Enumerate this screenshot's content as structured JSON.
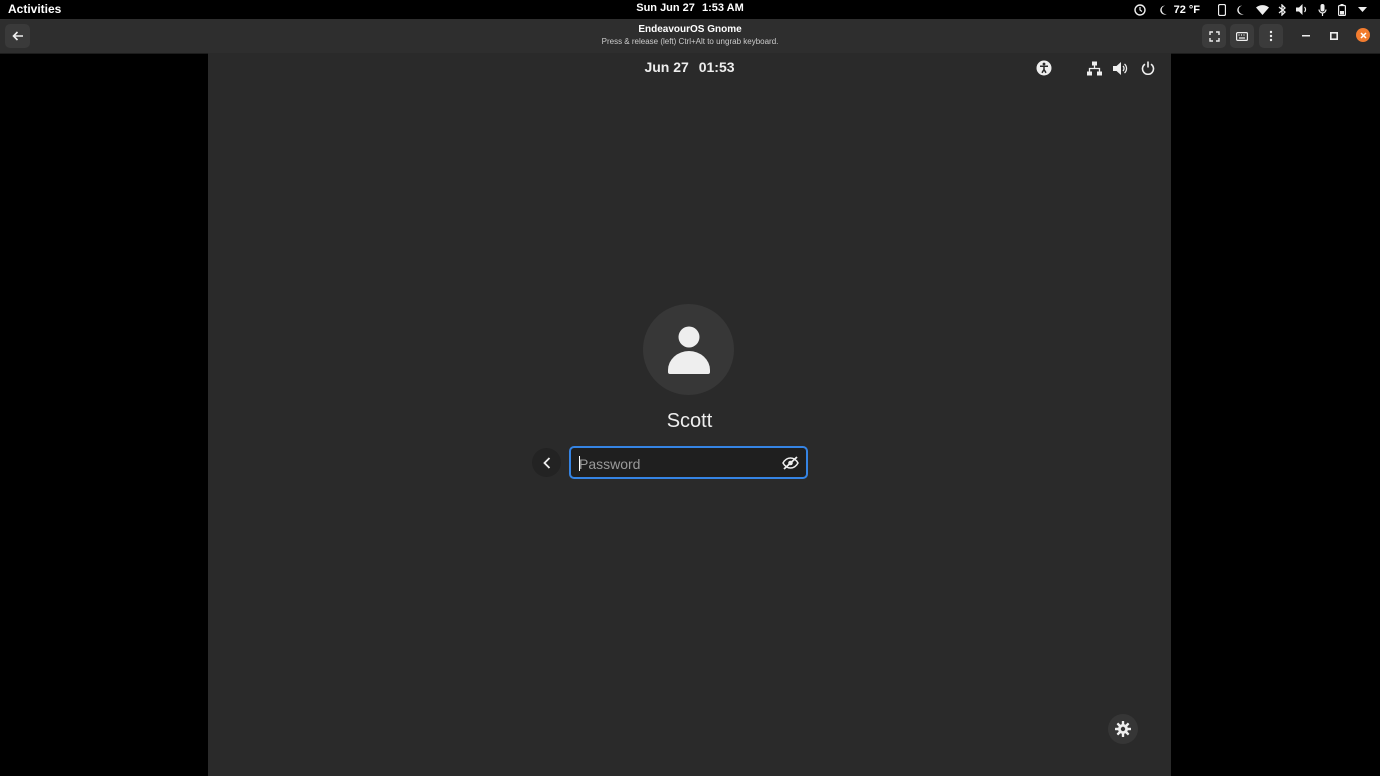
{
  "host_topbar": {
    "activities": "Activities",
    "date": "Sun Jun 27",
    "time": "1:53 AM",
    "weather": "72 °F"
  },
  "window": {
    "title": "EndeavourOS Gnome",
    "subtitle": "Press & release (left) Ctrl+Alt to ungrab keyboard.",
    "close_color": "#f27c2f"
  },
  "login": {
    "date": "Jun 27",
    "time": "01:53",
    "username": "Scott",
    "password_placeholder": "Password",
    "password_value": ""
  },
  "colors": {
    "accent": "#3584e4",
    "guest_bg": "#2a2a2a"
  },
  "icons": [
    "accessibility-icon",
    "network-icon",
    "volume-icon",
    "power-icon",
    "avatar-icon",
    "chevron-left-icon",
    "eye-slash-icon",
    "gear-icon"
  ]
}
